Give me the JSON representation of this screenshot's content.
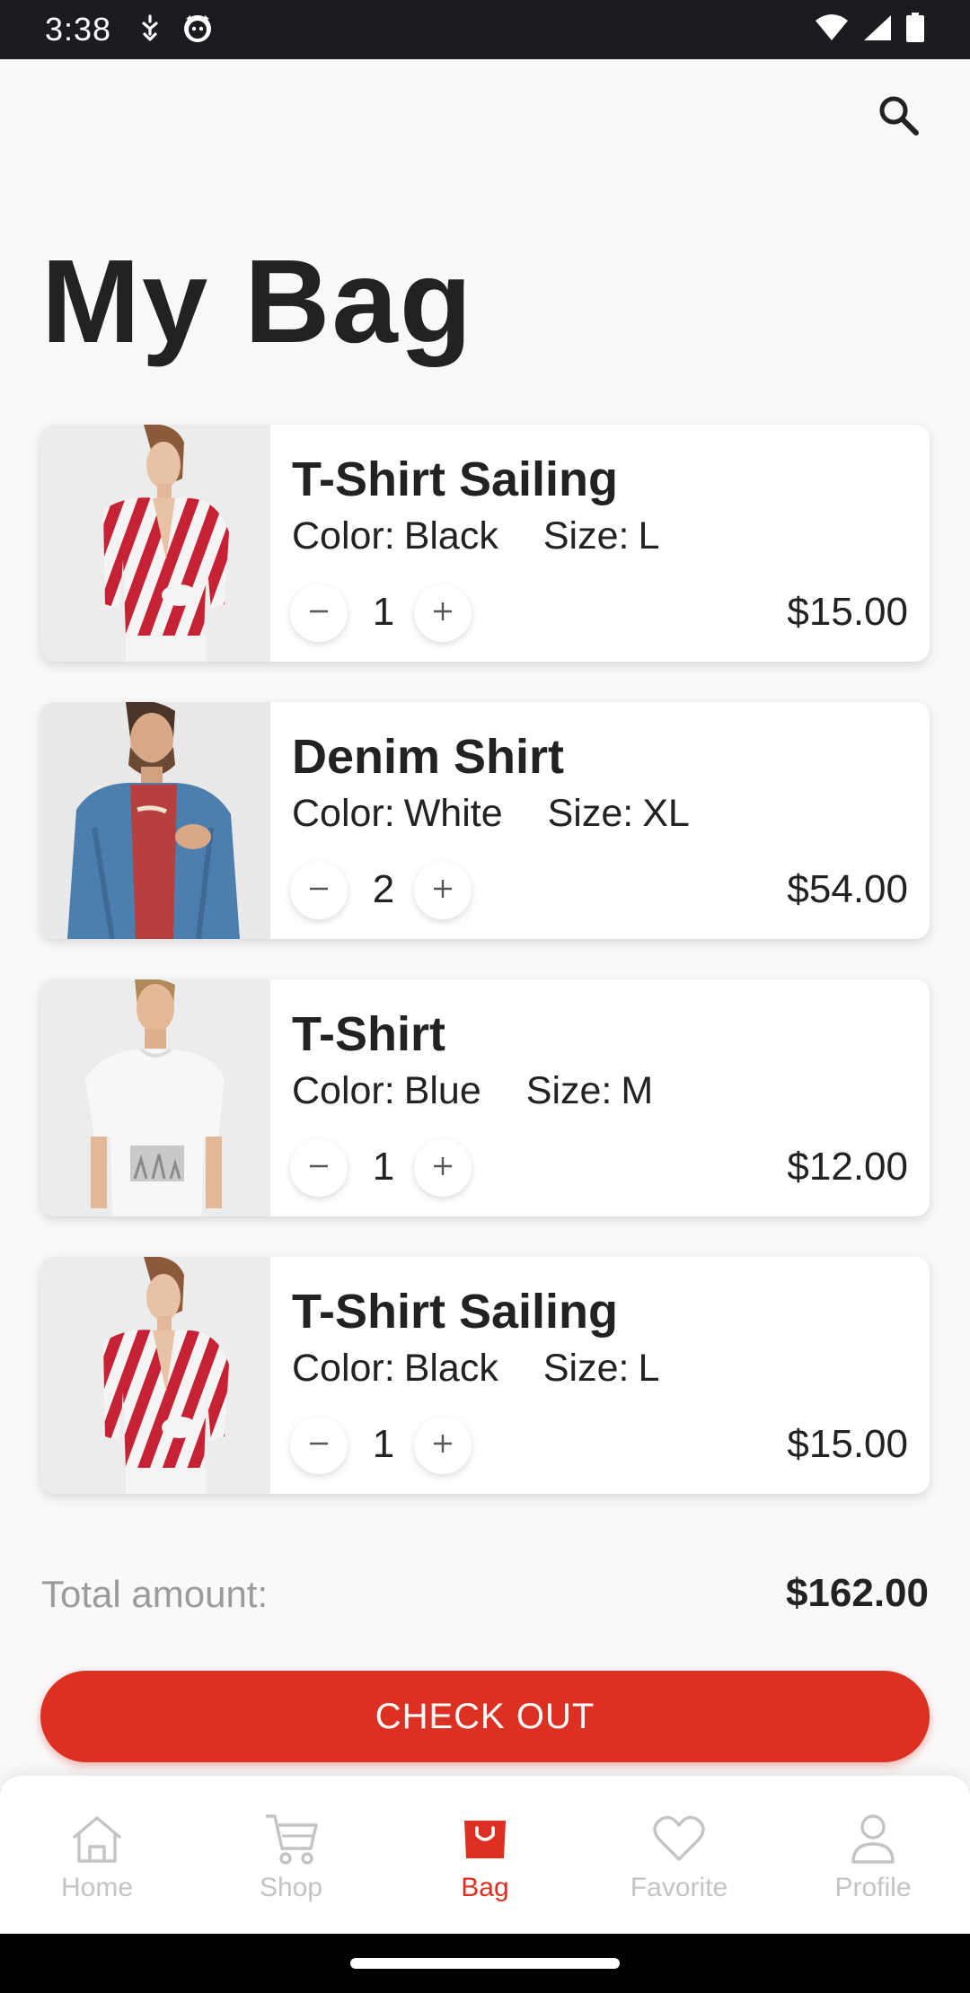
{
  "status_bar": {
    "time": "3:38"
  },
  "header": {
    "title": "My Bag"
  },
  "items": [
    {
      "name": "T-Shirt Sailing",
      "color_label": "Color:",
      "color": "Black",
      "size_label": "Size:",
      "size": "L",
      "quantity": "1",
      "price": "$15.00",
      "image": "red-white-striped-blouse"
    },
    {
      "name": "Denim Shirt",
      "color_label": "Color:",
      "color": "White",
      "size_label": "Size:",
      "size": "XL",
      "quantity": "2",
      "price": "$54.00",
      "image": "denim-shirt-over-red-tee"
    },
    {
      "name": "T-Shirt",
      "color_label": "Color:",
      "color": "Blue",
      "size_label": "Size:",
      "size": "M",
      "quantity": "1",
      "price": "$12.00",
      "image": "white-printed-tshirt"
    },
    {
      "name": "T-Shirt Sailing",
      "color_label": "Color:",
      "color": "Black",
      "size_label": "Size:",
      "size": "L",
      "quantity": "1",
      "price": "$15.00",
      "image": "red-white-striped-blouse"
    }
  ],
  "total": {
    "label": "Total amount:",
    "value": "$162.00"
  },
  "checkout": {
    "label": "CHECK OUT"
  },
  "nav": {
    "items": [
      {
        "label": "Home",
        "icon": "home-icon",
        "active": false
      },
      {
        "label": "Shop",
        "icon": "cart-icon",
        "active": false
      },
      {
        "label": "Bag",
        "icon": "bag-icon",
        "active": true
      },
      {
        "label": "Favorite",
        "icon": "heart-icon",
        "active": false
      },
      {
        "label": "Profile",
        "icon": "profile-icon",
        "active": false
      }
    ]
  },
  "colors": {
    "accent": "#db3022",
    "text_primary": "#222222",
    "text_secondary": "#9b9b9b",
    "nav_inactive": "#c4c4c4",
    "background": "#f9f9f9"
  }
}
